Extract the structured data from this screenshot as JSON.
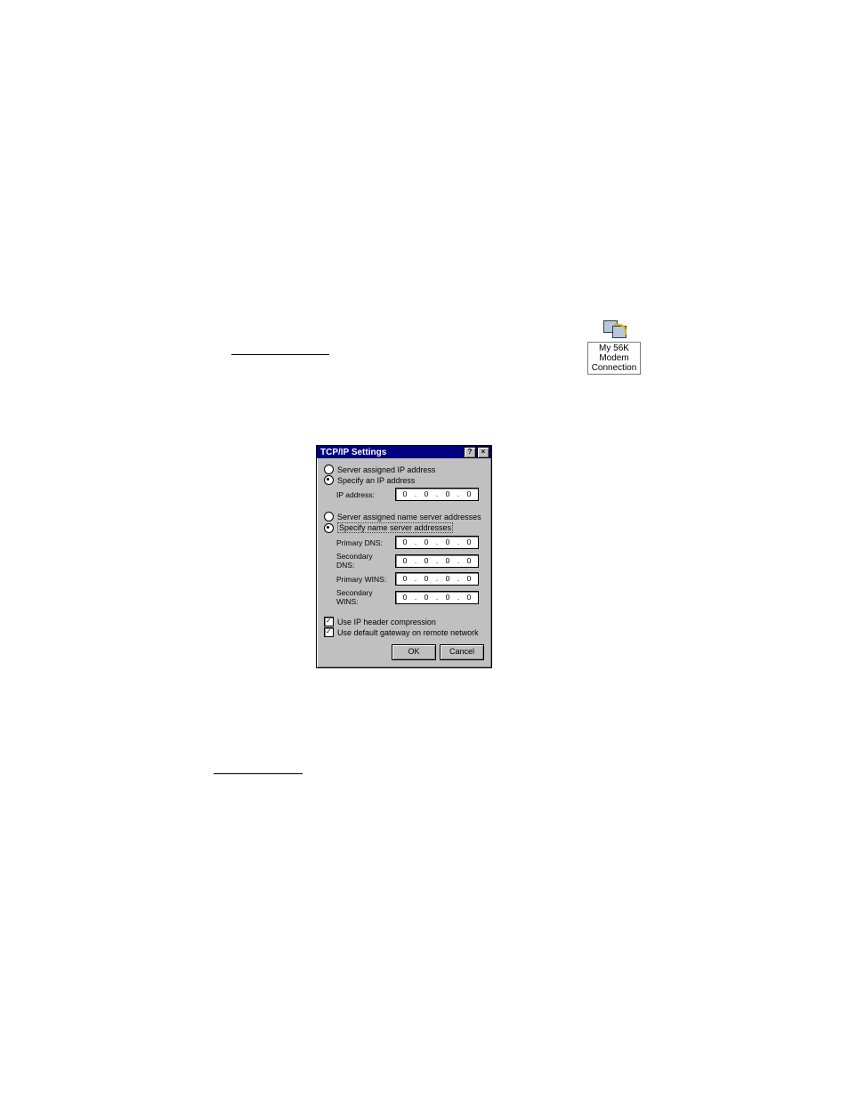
{
  "desktop_icon": {
    "name": "dialup-icon",
    "label": "My 56K\nModem\nConnection"
  },
  "dialog": {
    "title": "TCP/IP Settings",
    "titlebar_buttons": {
      "help": "?",
      "close": "×"
    },
    "radio_ip": {
      "server_assigned": "Server assigned IP address",
      "specify": "Specify an IP address",
      "selected": "specify"
    },
    "ip_address": {
      "label": "IP address:",
      "value": [
        "0",
        "0",
        "0",
        "0"
      ]
    },
    "radio_ns": {
      "server_assigned": "Server assigned name server addresses",
      "specify": "Specify name server addresses",
      "selected": "specify"
    },
    "dns_primary": {
      "label": "Primary DNS:",
      "value": [
        "0",
        "0",
        "0",
        "0"
      ]
    },
    "dns_secondary": {
      "label": "Secondary DNS:",
      "value": [
        "0",
        "0",
        "0",
        "0"
      ]
    },
    "wins_primary": {
      "label": "Primary WINS:",
      "value": [
        "0",
        "0",
        "0",
        "0"
      ]
    },
    "wins_secondary": {
      "label": "Secondary WINS:",
      "value": [
        "0",
        "0",
        "0",
        "0"
      ]
    },
    "check_compression": {
      "label": "Use IP header compression",
      "checked": true
    },
    "check_gateway": {
      "label": "Use default gateway on remote network",
      "checked": true
    },
    "buttons": {
      "ok": "OK",
      "cancel": "Cancel"
    }
  }
}
